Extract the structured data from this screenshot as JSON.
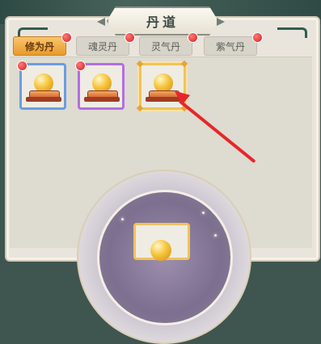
{
  "header": {
    "title": "丹道"
  },
  "tabs": [
    {
      "label": "修为丹",
      "active": true,
      "has_notice": true
    },
    {
      "label": "魂灵丹",
      "active": false,
      "has_notice": true
    },
    {
      "label": "灵气丹",
      "active": false,
      "has_notice": true
    },
    {
      "label": "紫气丹",
      "active": false,
      "has_notice": true
    }
  ],
  "pill_slots": [
    {
      "quality": "blue",
      "icon": "golden-pill-on-pedestal",
      "has_notice": true
    },
    {
      "quality": "purple",
      "icon": "golden-pill-on-pedestal",
      "has_notice": true
    },
    {
      "quality": "gold",
      "icon": "golden-pill-on-pedestal",
      "has_notice": false,
      "selected": true
    }
  ],
  "annotation": {
    "color": "#e5272a",
    "points_to": "gold-pill-slot"
  },
  "colors": {
    "accent": "#f0c35a",
    "notice": "#d11e1e",
    "panel": "#e9e5dc"
  }
}
